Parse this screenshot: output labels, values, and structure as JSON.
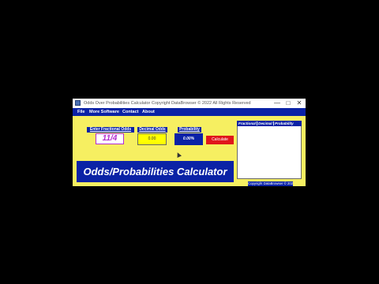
{
  "window": {
    "title": "Odds Over Probabilities Calculator Copyright DataBrowser © 2022 All Rights Reserved",
    "controls": [
      "—",
      "□",
      "✕"
    ]
  },
  "menu": {
    "items": [
      "File",
      "More Software",
      "Contact",
      "About"
    ]
  },
  "inputs": {
    "fractional_label": "Enter Fractional Odds",
    "fractional_value": "11/4",
    "decimal_label": "Decimal Odds",
    "decimal_value": "0.00",
    "probability_label": "Probability",
    "probability_value": "0.00%"
  },
  "calculate_button": "Calculate",
  "banner": "Odds/Probabilities Calculator",
  "results": {
    "columns": [
      "Fractional",
      "Decimal",
      "Probability"
    ]
  },
  "footer": {
    "copyright": "Copyright DataBrowser © 2022"
  },
  "colors": {
    "accent": "#0a22a6",
    "background": "#f6ef61",
    "button": "#e0161b",
    "fraction_text": "#b22bd0",
    "decimal_box": "#ffff00"
  },
  "icons": [
    "app-icon",
    "minimize-icon",
    "maximize-icon",
    "close-icon",
    "mouse-cursor-icon"
  ]
}
